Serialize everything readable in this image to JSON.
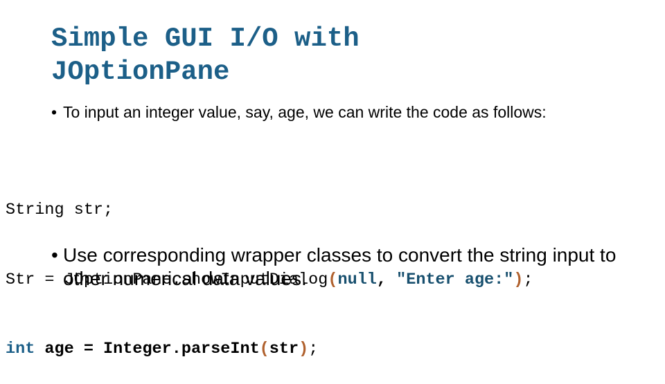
{
  "slide": {
    "title_line1": "Simple GUI I/O with",
    "title_line2": "JOptionPane",
    "bullet_char": "•",
    "bullet1": "To input an integer value, say, age, we can write the code as follows:",
    "bullet2": "Use corresponding wrapper classes to convert the string input to other numerical data values.",
    "colors": {
      "title": "#1c5f88",
      "keyword": "#1c5f88",
      "paren": "#b0612e",
      "string": "#174f6e"
    }
  },
  "code": {
    "line1": "String str;",
    "line2": {
      "prefix": "Str = JOptionPane.showInputDialog",
      "open_paren": "(",
      "arg1": "null",
      "comma": ", ",
      "arg2": "\"Enter age:\"",
      "close_paren": ")",
      "end": ";"
    },
    "line3": {
      "keyword": "int",
      "body": " age = Integer.parseInt",
      "open_paren": "(",
      "arg": "str",
      "close_paren": ")",
      "end": ";"
    }
  }
}
